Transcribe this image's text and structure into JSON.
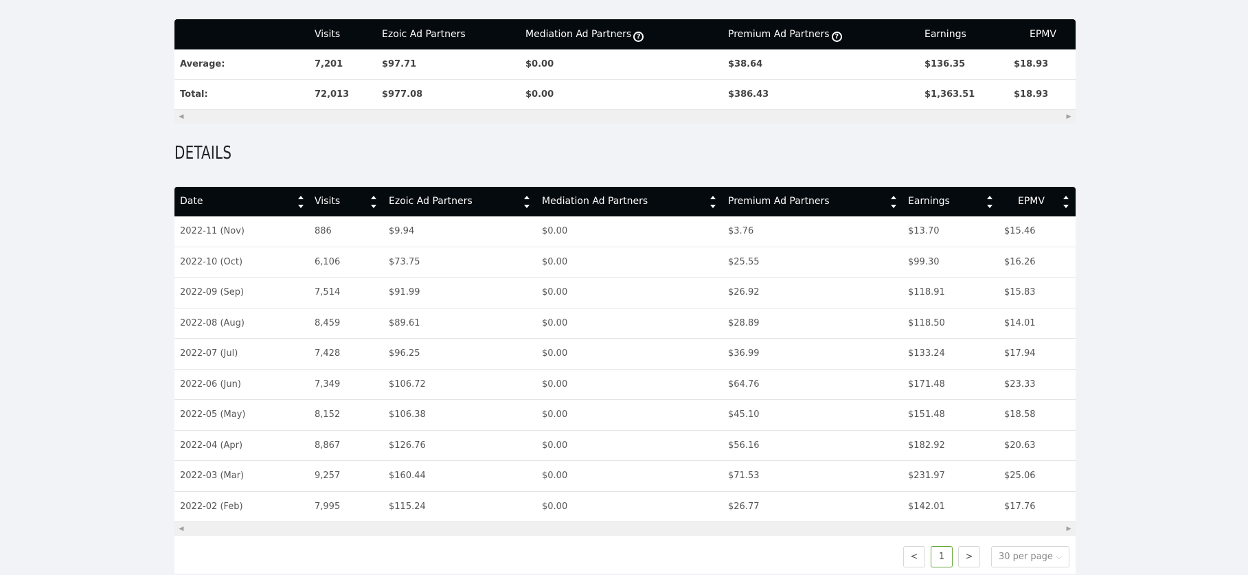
{
  "summary": {
    "headers": [
      "",
      "Visits",
      "Ezoic Ad Partners",
      "Mediation Ad Partners",
      "Premium Ad Partners",
      "Earnings",
      "EPMV"
    ],
    "rows": [
      {
        "label": "Average:",
        "cells": [
          "7,201",
          "$97.71",
          "$0.00",
          "$38.64",
          "$136.35",
          "$18.93"
        ]
      },
      {
        "label": "Total:",
        "cells": [
          "72,013",
          "$977.08",
          "$0.00",
          "$386.43",
          "$1,363.51",
          "$18.93"
        ]
      }
    ],
    "help_icon": "question-circle-icon"
  },
  "details": {
    "title": "DETAILS",
    "headers": [
      "Date",
      "Visits",
      "Ezoic Ad Partners",
      "Mediation Ad Partners",
      "Premium Ad Partners",
      "Earnings",
      "EPMV"
    ],
    "rows": [
      [
        "2022-11 (Nov)",
        "886",
        "$9.94",
        "$0.00",
        "$3.76",
        "$13.70",
        "$15.46"
      ],
      [
        "2022-10 (Oct)",
        "6,106",
        "$73.75",
        "$0.00",
        "$25.55",
        "$99.30",
        "$16.26"
      ],
      [
        "2022-09 (Sep)",
        "7,514",
        "$91.99",
        "$0.00",
        "$26.92",
        "$118.91",
        "$15.83"
      ],
      [
        "2022-08 (Aug)",
        "8,459",
        "$89.61",
        "$0.00",
        "$28.89",
        "$118.50",
        "$14.01"
      ],
      [
        "2022-07 (Jul)",
        "7,428",
        "$96.25",
        "$0.00",
        "$36.99",
        "$133.24",
        "$17.94"
      ],
      [
        "2022-06 (Jun)",
        "7,349",
        "$106.72",
        "$0.00",
        "$64.76",
        "$171.48",
        "$23.33"
      ],
      [
        "2022-05 (May)",
        "8,152",
        "$106.38",
        "$0.00",
        "$45.10",
        "$151.48",
        "$18.58"
      ],
      [
        "2022-04 (Apr)",
        "8,867",
        "$126.76",
        "$0.00",
        "$56.16",
        "$182.92",
        "$20.63"
      ],
      [
        "2022-03 (Mar)",
        "9,257",
        "$160.44",
        "$0.00",
        "$71.53",
        "$231.97",
        "$25.06"
      ],
      [
        "2022-02 (Feb)",
        "7,995",
        "$115.24",
        "$0.00",
        "$26.77",
        "$142.01",
        "$17.76"
      ]
    ]
  },
  "pagination": {
    "prev": "<",
    "current_page": "1",
    "next": ">",
    "per_page": "30 per page",
    "per_page_chevron": "⌵"
  },
  "scroll_arrows": {
    "left": "◀",
    "right": "▶"
  },
  "colors": {
    "header_bg": "#050a0e",
    "page_bg": "#f2f3f7",
    "active_page_border": "#66a83a"
  }
}
